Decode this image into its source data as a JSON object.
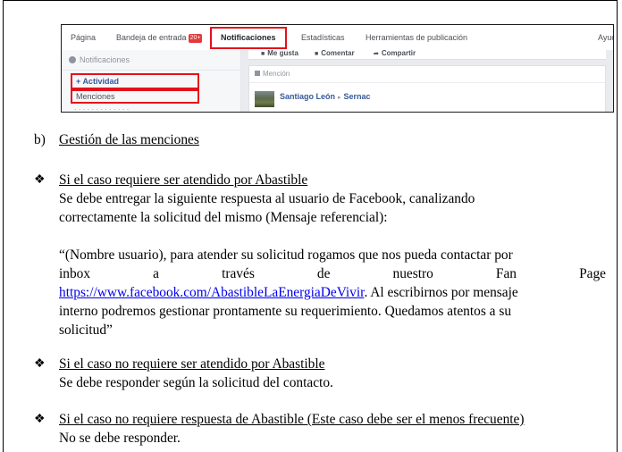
{
  "facebook": {
    "tabs": [
      {
        "label": "Página"
      },
      {
        "label": "Bandeja de entrada",
        "badge": "20+"
      },
      {
        "label": "Notificaciones"
      },
      {
        "label": "Estadísticas"
      },
      {
        "label": "Herramientas de publicación"
      },
      {
        "label": "Ayud"
      }
    ],
    "sidebar": {
      "header": "Notificaciones",
      "active_item": "Actividad",
      "second_item": "Menciones"
    },
    "actions": [
      "Me gusta",
      "Comentar",
      "Compartir"
    ],
    "card": {
      "header": "Mención",
      "author": "Santiago León",
      "page": "Sernac"
    }
  },
  "document": {
    "section_marker": "b)",
    "section_title": "Gestión de las menciones",
    "bullet_glyph": "❖",
    "case1": {
      "title": "Si el caso requiere ser atendido por Abastible",
      "line1": "Se debe entregar la siguiente respuesta al usuario de Facebook, canalizando",
      "line2": "correctamente la solicitud del mismo (Mensaje referencial):",
      "quote": {
        "line1": "“(Nombre usuario), para atender su solicitud rogamos que nos pueda contactar por",
        "line2_words": [
          "inbox",
          "a",
          "través",
          "de",
          "nuestro",
          "Fan",
          "Page"
        ],
        "link": "https://www.facebook.com/AbastibleLaEnergiaDeVivir",
        "line3_rest": ". Al escribirnos por mensaje",
        "line4": "interno podremos gestionar prontamente su requerimiento. Quedamos atentos a su",
        "line5": "solicitud”"
      }
    },
    "case2": {
      "title": "Si el caso no requiere ser atendido por Abastible",
      "body": "Se debe responder según la solicitud del contacto."
    },
    "case3": {
      "title": "Si el caso no requiere respuesta de Abastible (Este caso debe ser el menos frecuente)",
      "body": "No se debe responder."
    }
  }
}
